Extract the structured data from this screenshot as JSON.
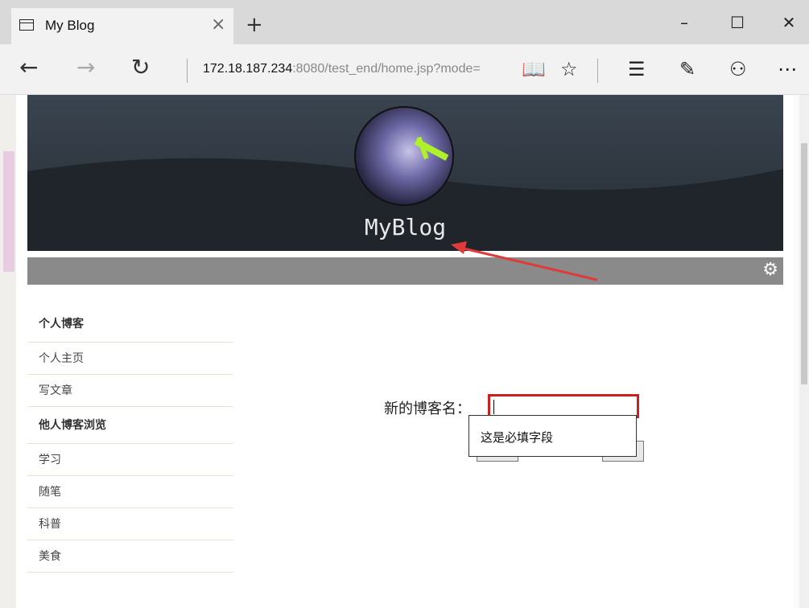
{
  "browser": {
    "tab_title": "My Blog",
    "tab_close": "×",
    "new_tab": "+",
    "win_min": "–",
    "win_max": "☐",
    "win_close": "✕",
    "back": "←",
    "forward": "→",
    "refresh": "↻",
    "url_host": "172.18.187.234",
    "url_rest": ":8080/test_end/home.jsp?mode=",
    "reading_view": "📖",
    "favorite": "☆",
    "hub": "☰",
    "web_note": "✎",
    "share": "⚇",
    "more": "⋯"
  },
  "blog": {
    "title": "MyBlog",
    "settings_icon": "⚙"
  },
  "sidebar": {
    "sections": [
      {
        "heading": "个人博客",
        "items": [
          "个人主页",
          "写文章"
        ]
      },
      {
        "heading": "他人博客浏览",
        "items": [
          "学习",
          "随笔",
          "科普",
          "美食"
        ]
      }
    ]
  },
  "form": {
    "label": "新的博客名：",
    "input_value": "",
    "validation_message": "这是必填字段"
  },
  "colors": {
    "header_bg": "#2f3740",
    "accent_lime": "#aef02a",
    "error_red": "#cc1f1f",
    "toolbar_gray": "#8a8a8a"
  }
}
